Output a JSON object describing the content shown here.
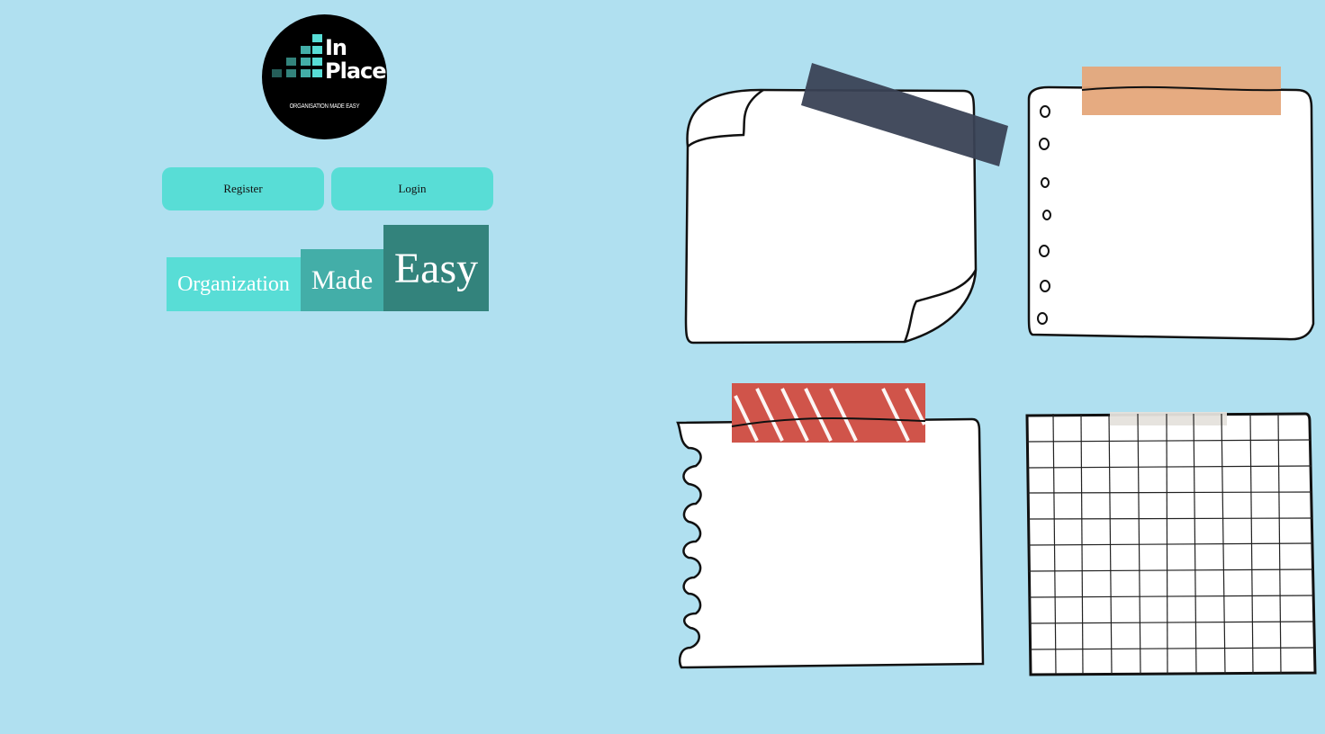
{
  "logo": {
    "name_line1": "In",
    "name_line2": "Place",
    "tagline": "ORGANISATION MADE EASY"
  },
  "buttons": {
    "register_label": "Register",
    "login_label": "Login"
  },
  "slogan": {
    "word1": "Organization",
    "word2": "Made",
    "word3": "Easy"
  },
  "colors": {
    "background": "#b0e0f0",
    "button": "#58ddd6",
    "slogan_1": "#58ddd6",
    "slogan_2": "#43aea8",
    "slogan_3": "#33837c",
    "tape_navy": "#3a4255",
    "tape_orange": "#e5a67a",
    "tape_red": "#d0544a"
  },
  "notes": [
    {
      "icon": "folded-corner-note-icon",
      "tape": "navy"
    },
    {
      "icon": "ring-bound-note-icon",
      "tape": "orange"
    },
    {
      "icon": "torn-edge-note-icon",
      "tape": "red-striped"
    },
    {
      "icon": "grid-paper-note-icon",
      "tape": "grey"
    }
  ]
}
